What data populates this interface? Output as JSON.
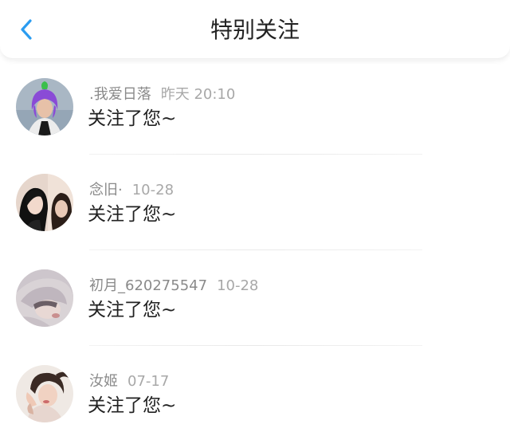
{
  "header": {
    "title": "特别关注",
    "back_icon": "chevron-left-icon",
    "accent_color": "#2b9cf0"
  },
  "items": [
    {
      "name": ".我爱日落",
      "time": "昨天 20:10",
      "message": "关注了您~"
    },
    {
      "name": "念旧·",
      "time": "10-28",
      "message": "关注了您~"
    },
    {
      "name": "初月_620275547",
      "time": "10-28",
      "message": "关注了您~"
    },
    {
      "name": "汝姬",
      "time": "07-17",
      "message": "关注了您~"
    }
  ]
}
